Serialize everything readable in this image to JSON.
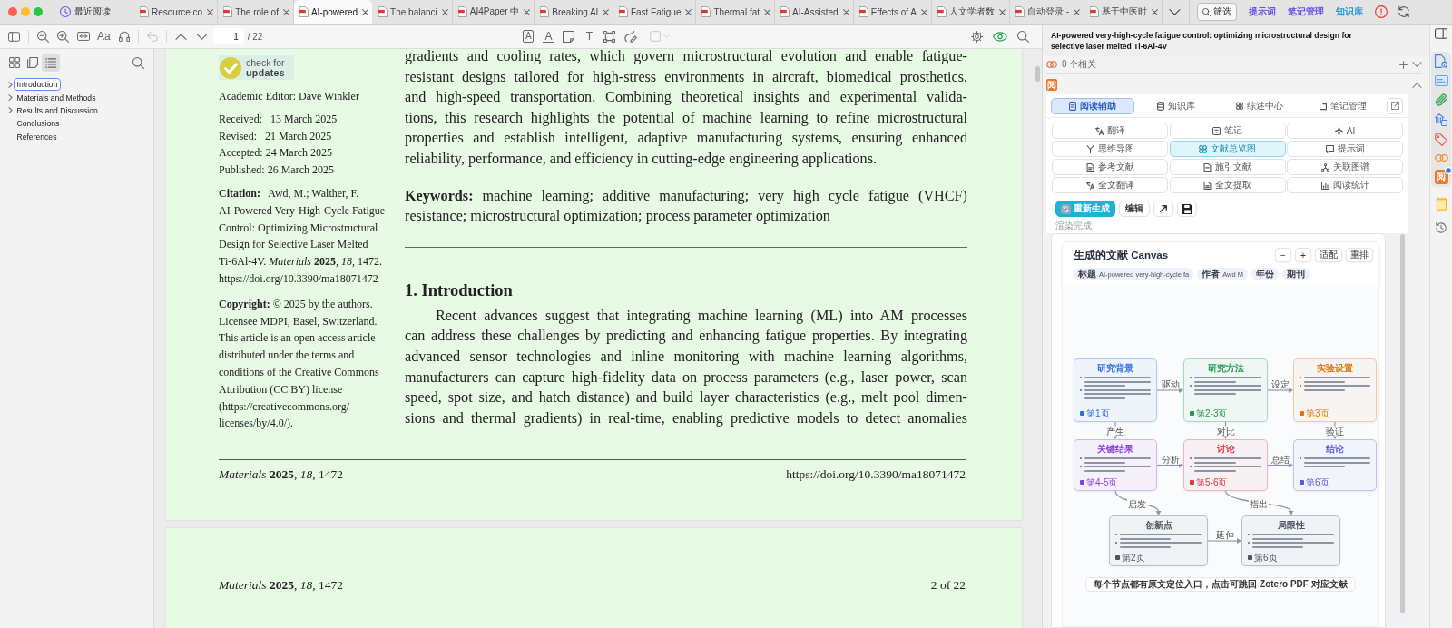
{
  "tab_bar": {
    "recent": "最近阅读",
    "tabs": [
      {
        "label": "Resource co",
        "selected": false
      },
      {
        "label": "The role of",
        "selected": false
      },
      {
        "label": "AI-powered",
        "selected": true
      },
      {
        "label": "The balanci",
        "selected": false
      },
      {
        "label": "AI4Paper 中",
        "selected": false
      },
      {
        "label": "Breaking Al",
        "selected": false
      },
      {
        "label": "Fast Fatigue",
        "selected": false
      },
      {
        "label": "Thermal fat",
        "selected": false
      },
      {
        "label": "AI-Assisted",
        "selected": false
      },
      {
        "label": "Effects of A",
        "selected": false
      },
      {
        "label": "人文学者数",
        "selected": false
      },
      {
        "label": "自动登录 -",
        "selected": false
      },
      {
        "label": "基于中医时",
        "selected": false
      }
    ],
    "filter_button": "筛选",
    "links": [
      {
        "label": "提示词",
        "color": "#6a52e6"
      },
      {
        "label": "笔记管理",
        "color": "#6a52e6"
      },
      {
        "label": "知识库",
        "color": "#1b94d6"
      }
    ]
  },
  "toolbar": {
    "font_button": "Aa",
    "undo": {
      "disabled": true
    },
    "page_input": "1",
    "page_total": "/ 22",
    "annotation_tools": [
      {
        "kind": "highlight-text",
        "glyph": "A"
      },
      {
        "kind": "underline-text",
        "glyph": "A"
      },
      {
        "kind": "note"
      },
      {
        "kind": "text",
        "glyph": "T"
      },
      {
        "kind": "area"
      },
      {
        "kind": "draw"
      }
    ],
    "color_picker": {
      "disabled": true
    }
  },
  "sidebar": {
    "views": [
      {
        "kind": "thumbnails",
        "selected": false
      },
      {
        "kind": "annotations",
        "selected": false
      },
      {
        "kind": "outline",
        "selected": true
      }
    ],
    "outline": [
      {
        "label": "Introduction",
        "expandable": true,
        "selected": true
      },
      {
        "label": "Materials and Methods",
        "expandable": true,
        "selected": false
      },
      {
        "label": "Results and Discussion",
        "expandable": true,
        "selected": false
      },
      {
        "label": "Conclusions",
        "expandable": false,
        "selected": false
      },
      {
        "label": "References",
        "expandable": false,
        "selected": false
      }
    ]
  },
  "document": {
    "page_1": {
      "badge": {
        "line_1": "check for",
        "line_2": "updates"
      },
      "academic_editor": "Academic Editor: Dave Winkler",
      "dates": [
        "Received:   13 March 2025",
        "Revised:   21 March 2025",
        "Accepted: 24 March 2025",
        "Published: 26 March 2025"
      ],
      "citation": [
        "**Citation:**   Awd, M.; Walther, F.",
        "AI-Powered Very-High-Cycle Fatigue",
        "Control: Optimizing Microstructural",
        "Design for Selective Laser Melted",
        "Ti-6Al-4V. *Materials* **2025**, *18*, 1472.",
        "https://doi.org/10.3390/ma18071472"
      ],
      "copyright": [
        "**Copyright:** © 2025 by the authors.",
        "Licensee MDPI, Basel, Switzerland.",
        "This article is an open access article",
        "distributed under the terms and",
        "conditions of the Creative Commons",
        "Attribution (CC BY) license",
        "(https://creativecommons.org/",
        "licenses/by/4.0/)."
      ],
      "abstract_end": [
        "gradients and cooling rates, which govern microstructural evolution and enable fatigue-",
        "resistant designs tailored for high-stress environments in aircraft, biomedical prosthetics,",
        "and high-speed transportation. Combining theoretical insights and experimental valida-",
        "tions, this research highlights the potential of machine learning to refine microstructural",
        "properties and establish intelligent, adaptive manufacturing systems, ensuring enhanced",
        "reliability, performance, and efficiency in cutting-edge engineering applications."
      ],
      "keywords": [
        "**Keywords:** machine learning; additive manufacturing; very high cycle fatigue (VHCF)",
        "resistance; microstructural optimization; process parameter optimization"
      ],
      "section_heading": "1. Introduction",
      "introduction": [
        "Recent advances suggest that integrating machine learning (ML) into AM processes",
        "can address these challenges by predicting and enhancing fatigue properties. By integrating",
        "advanced sensor technologies and inline monitoring with machine learning algorithms,",
        "manufacturers can capture high-fidelity data on process parameters (e.g., laser power, scan",
        "speed, spot size, and hatch distance) and build layer characteristics (e.g., melt pool dimen-",
        "sions and thermal gradients) in real-time, enabling predictive models to detect anomalies"
      ],
      "footer": {
        "journal": "*Materials* **2025**, *18*, 1472",
        "doi": "https://doi.org/10.3390/ma18071472"
      }
    },
    "page_2": {
      "header": {
        "journal": "*Materials* **2025**, *18*, 1472",
        "page": "2 of 22"
      }
    }
  },
  "right_panel": {
    "title": "AI-powered very-high-cycle fatigue control: optimizing microstructural design for selective laser melted Ti-6Al-4V",
    "related": "0 个相关",
    "plugin_icon": "阅",
    "tabs": [
      {
        "label": "阅读辅助",
        "selected": true
      },
      {
        "label": "知识库",
        "selected": false
      },
      {
        "label": "综述中心",
        "selected": false
      },
      {
        "label": "笔记管理",
        "selected": false
      }
    ],
    "features": [
      {
        "label": "翻译",
        "selected": false
      },
      {
        "label": "笔记",
        "selected": false
      },
      {
        "label": "AI",
        "selected": false
      },
      {
        "label": "思维导图",
        "selected": false
      },
      {
        "label": "文献总览图",
        "selected": true
      },
      {
        "label": "提示词",
        "selected": false
      },
      {
        "label": "参考文献",
        "selected": false
      },
      {
        "label": "施引文献",
        "selected": false
      },
      {
        "label": "关联图谱",
        "selected": false
      },
      {
        "label": "全文翻译",
        "selected": false
      },
      {
        "label": "全文提取",
        "selected": false
      },
      {
        "label": "阅读统计",
        "selected": false
      }
    ],
    "actions": [
      {
        "kind": "primary",
        "label": "重新生成"
      },
      {
        "kind": "plain",
        "label": "编辑"
      },
      {
        "kind": "open"
      },
      {
        "kind": "save"
      }
    ],
    "status": "渲染完成",
    "canvas": {
      "title": "生成的文献 Canvas",
      "chips": [
        {
          "label": "标题",
          "value": "AI-powered very-high-cycle fa"
        },
        {
          "label": "作者",
          "value": "Awd M"
        },
        {
          "label": "年份"
        },
        {
          "label": "期刊"
        }
      ],
      "controls": [
        "−",
        "+",
        "适配",
        "重排"
      ],
      "nodes": [
        {
          "title": "研究背景",
          "color": "#2f6fde",
          "page_ref": "第1页"
        },
        {
          "title": "研究方法",
          "color": "#1f9d4c",
          "page_ref": "第2-3页"
        },
        {
          "title": "实验设置",
          "color": "#d9770b",
          "page_ref": "第3页"
        },
        {
          "title": "关键结果",
          "color": "#8b3fe0",
          "page_ref": "第4-5页"
        },
        {
          "title": "讨论",
          "color": "#dc3545",
          "page_ref": "第5-6页"
        },
        {
          "title": "结论",
          "color": "#5b5bd6",
          "page_ref": "第6页"
        },
        {
          "title": "创新点",
          "color": "#4b5563",
          "page_ref": "第2页"
        },
        {
          "title": "局限性",
          "color": "#4b5563",
          "page_ref": "第6页"
        }
      ],
      "edges": [
        {
          "label": "驱动"
        },
        {
          "label": "设定"
        },
        {
          "label": "产生"
        },
        {
          "label": "对比"
        },
        {
          "label": "验证"
        },
        {
          "label": "分析"
        },
        {
          "label": "总结"
        },
        {
          "label": "启发"
        },
        {
          "label": "指出"
        },
        {
          "label": "延伸"
        }
      ],
      "note": "每个节点都有原文定位入口，点击可跳回 Zotero PDF 对应文献"
    }
  },
  "side_bar": {
    "reader_icon": "阅",
    "notification": true
  }
}
